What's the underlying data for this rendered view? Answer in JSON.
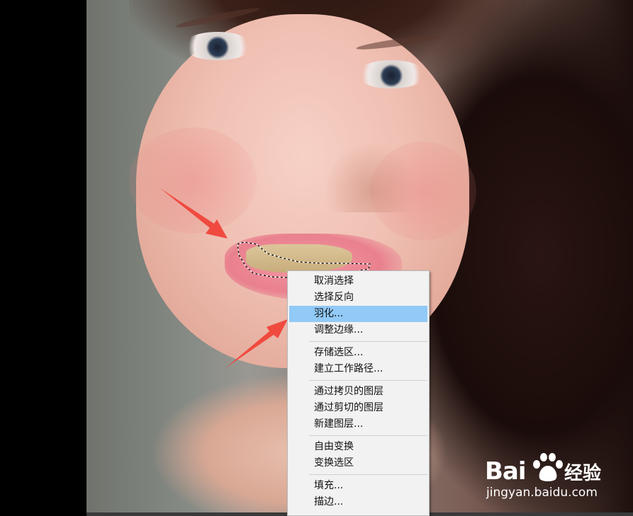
{
  "context_menu": {
    "highlighted_index": 2,
    "groups": [
      [
        "取消选择",
        "选择反向",
        "羽化...",
        "调整边缘..."
      ],
      [
        "存储选区...",
        "建立工作路径..."
      ],
      [
        "通过拷贝的图层",
        "通过剪切的图层",
        "新建图层..."
      ],
      [
        "自由变换",
        "变换选区"
      ],
      [
        "填充...",
        "描边..."
      ]
    ]
  },
  "watermark": {
    "brand": "Bai",
    "brand_suffix": "经验",
    "url": "jingyan.baidu.com"
  },
  "colors": {
    "menu_bg": "#f2f2f2",
    "menu_highlight": "#91c9f7",
    "arrow": "#f04a3f"
  },
  "icons": {
    "arrow": "annotation-arrow-icon",
    "paw": "baidu-paw-icon"
  }
}
